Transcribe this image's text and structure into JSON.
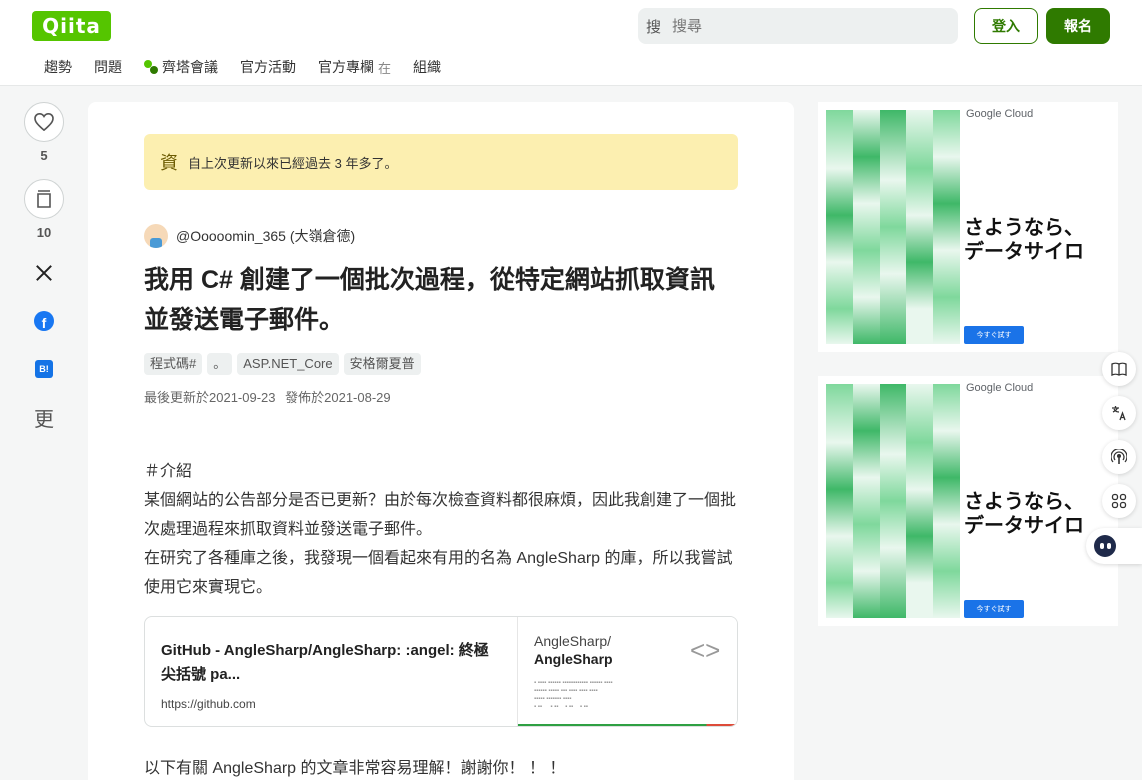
{
  "header": {
    "logo_text": "Qiita",
    "search_icon": "搜",
    "search_placeholder": "搜尋",
    "login_label": "登入",
    "signup_label": "報名",
    "nav": [
      {
        "label": "趨勢"
      },
      {
        "label": "問題"
      },
      {
        "label": "齊塔會議"
      },
      {
        "label": "官方活動"
      },
      {
        "label": "官方專欄",
        "ext": "在"
      },
      {
        "label": "組織"
      }
    ]
  },
  "social": {
    "like_count": "5",
    "stock_count": "10",
    "more_label": "更"
  },
  "article": {
    "notice_icon": "資",
    "notice_text": "自上次更新以來已經過去 3 年多了。",
    "author": "@Ooooomin_365 (大嶺倉德)",
    "title": "我用 C# 創建了一個批次過程，從特定網站抓取資訊並發送電子郵件。",
    "tags": [
      "程式碼#",
      "。",
      "ASP.NET_Core",
      "安格爾夏普"
    ],
    "updated": "最後更新於2021-09-23",
    "published": "發佈於2021-08-29",
    "body": [
      "＃介紹",
      "某個網站的公告部分是否已更新？由於每次檢查資料都很麻煩，因此我創建了一個批次處理過程來抓取資料並發送電子郵件。",
      "在研究了各種庫之後，我發現一個看起來有用的名為 AngleSharp 的庫，所以我嘗試使用它來實現它。"
    ],
    "link_card": {
      "title": "GitHub - AngleSharp/AngleSharp: :angel: 終極尖括號 pa...",
      "url": "https://github.com",
      "repo_owner": "AngleSharp/",
      "repo_name": "AngleSharp"
    },
    "after_text": "以下有關 AngleSharp 的文章非常容易理解！謝謝你！ ！ ！"
  },
  "ads": [
    {
      "brand": "Google Cloud",
      "headline_1": "さようなら、",
      "headline_2": "データサイロ",
      "button": "今すぐ試す"
    },
    {
      "brand": "Google Cloud",
      "headline_1": "さようなら、",
      "headline_2": "データサイロ",
      "button": "今すぐ試す"
    }
  ],
  "icons": {
    "like": "heart-icon",
    "stock": "bookmark-icon",
    "x": "x-logo-icon",
    "facebook": "facebook-icon",
    "hatena": "hatena-bookmark-icon"
  },
  "colors": {
    "brand": "#55c500",
    "brand_dark": "#2f7a00",
    "notice_bg": "#fcefb0"
  }
}
